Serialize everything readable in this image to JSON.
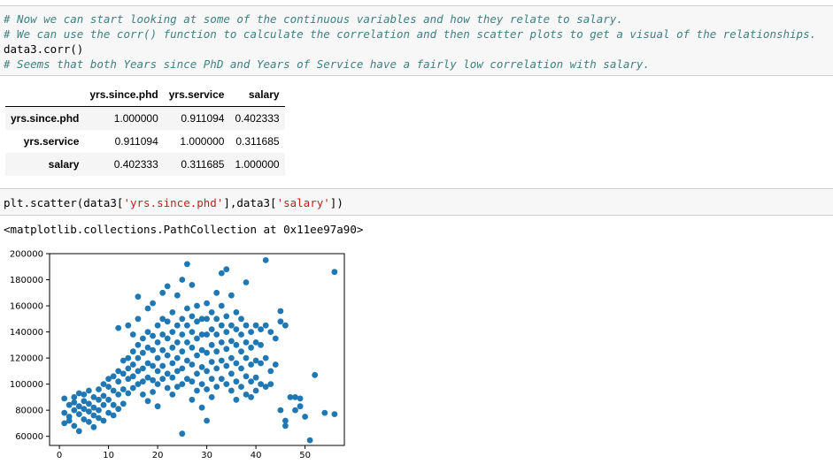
{
  "cell1": {
    "lines": [
      {
        "kind": "comment",
        "text": "# Now we can start looking at some of the continuous variables and how they relate to salary."
      },
      {
        "kind": "comment",
        "text": "# We can use the corr() function to calculate the correlation and then scatter plots to get a visual of the relationships."
      },
      {
        "kind": "plain",
        "text": "data3.corr()"
      },
      {
        "kind": "comment",
        "text": "# Seems that both Years since PhD and Years of Service have a fairly low correlation with salary."
      }
    ]
  },
  "corr_table": {
    "columns": [
      "yrs.since.phd",
      "yrs.service",
      "salary"
    ],
    "rows": [
      {
        "label": "yrs.since.phd",
        "values": [
          "1.000000",
          "0.911094",
          "0.402333"
        ]
      },
      {
        "label": "yrs.service",
        "values": [
          "0.911094",
          "1.000000",
          "0.311685"
        ]
      },
      {
        "label": "salary",
        "values": [
          "0.402333",
          "0.311685",
          "1.000000"
        ]
      }
    ]
  },
  "cell2": {
    "prefix": "plt.scatter(data3[",
    "str1": "'yrs.since.phd'",
    "mid": "],data3[",
    "str2": "'salary'",
    "suffix": "])"
  },
  "output_text": "<matplotlib.collections.PathCollection at 0x11ee97a90>",
  "chart_data": {
    "type": "scatter",
    "xlim": [
      -2,
      58
    ],
    "ylim": [
      53000,
      200000
    ],
    "x_ticks": [
      0,
      10,
      20,
      30,
      40,
      50
    ],
    "y_ticks": [
      60000,
      80000,
      100000,
      120000,
      140000,
      160000,
      180000,
      200000
    ],
    "point_color": "#1f77b4",
    "points": [
      [
        1,
        89000
      ],
      [
        1,
        78000
      ],
      [
        1,
        70000
      ],
      [
        2,
        84000
      ],
      [
        2,
        75000
      ],
      [
        2,
        72000
      ],
      [
        3,
        90000
      ],
      [
        3,
        80000
      ],
      [
        3,
        68000
      ],
      [
        3,
        86000
      ],
      [
        4,
        93000
      ],
      [
        4,
        83000
      ],
      [
        4,
        64000
      ],
      [
        4,
        77000
      ],
      [
        5,
        92000
      ],
      [
        5,
        81000
      ],
      [
        5,
        73000
      ],
      [
        5,
        87000
      ],
      [
        6,
        95000
      ],
      [
        6,
        85000
      ],
      [
        6,
        71000
      ],
      [
        6,
        79000
      ],
      [
        7,
        90000
      ],
      [
        7,
        82000
      ],
      [
        7,
        76000
      ],
      [
        7,
        67000
      ],
      [
        8,
        96000
      ],
      [
        8,
        88000
      ],
      [
        8,
        80000
      ],
      [
        8,
        74000
      ],
      [
        9,
        100000
      ],
      [
        9,
        91000
      ],
      [
        9,
        84000
      ],
      [
        9,
        72000
      ],
      [
        10,
        104000
      ],
      [
        10,
        98000
      ],
      [
        10,
        88000
      ],
      [
        10,
        78000
      ],
      [
        11,
        106000
      ],
      [
        11,
        95000
      ],
      [
        11,
        84000
      ],
      [
        11,
        76000
      ],
      [
        12,
        110000
      ],
      [
        12,
        102000
      ],
      [
        12,
        92000
      ],
      [
        12,
        81000
      ],
      [
        12,
        143000
      ],
      [
        13,
        118000
      ],
      [
        13,
        108000
      ],
      [
        13,
        96000
      ],
      [
        13,
        85000
      ],
      [
        14,
        120000
      ],
      [
        14,
        112000
      ],
      [
        14,
        104000
      ],
      [
        14,
        93000
      ],
      [
        14,
        145000
      ],
      [
        15,
        125000
      ],
      [
        15,
        115000
      ],
      [
        15,
        106000
      ],
      [
        15,
        97000
      ],
      [
        15,
        138000
      ],
      [
        16,
        130000
      ],
      [
        16,
        120000
      ],
      [
        16,
        110000
      ],
      [
        16,
        100000
      ],
      [
        16,
        150000
      ],
      [
        16,
        167000
      ],
      [
        17,
        135000
      ],
      [
        17,
        124000
      ],
      [
        17,
        112000
      ],
      [
        17,
        102000
      ],
      [
        17,
        92000
      ],
      [
        18,
        140000
      ],
      [
        18,
        128000
      ],
      [
        18,
        116000
      ],
      [
        18,
        105000
      ],
      [
        18,
        87000
      ],
      [
        18,
        158000
      ],
      [
        19,
        137000
      ],
      [
        19,
        126000
      ],
      [
        19,
        114000
      ],
      [
        19,
        103000
      ],
      [
        19,
        94000
      ],
      [
        19,
        162000
      ],
      [
        20,
        145000
      ],
      [
        20,
        132000
      ],
      [
        20,
        120000
      ],
      [
        20,
        110000
      ],
      [
        20,
        100000
      ],
      [
        20,
        83000
      ],
      [
        21,
        150000
      ],
      [
        21,
        138000
      ],
      [
        21,
        126000
      ],
      [
        21,
        114000
      ],
      [
        21,
        104000
      ],
      [
        21,
        170000
      ],
      [
        22,
        148000
      ],
      [
        22,
        135000
      ],
      [
        22,
        122000
      ],
      [
        22,
        108000
      ],
      [
        22,
        97000
      ],
      [
        22,
        175000
      ],
      [
        23,
        155000
      ],
      [
        23,
        140000
      ],
      [
        23,
        128000
      ],
      [
        23,
        116000
      ],
      [
        23,
        105000
      ],
      [
        23,
        92000
      ],
      [
        24,
        145000
      ],
      [
        24,
        132000
      ],
      [
        24,
        120000
      ],
      [
        24,
        110000
      ],
      [
        24,
        98000
      ],
      [
        24,
        168000
      ],
      [
        25,
        150000
      ],
      [
        25,
        138000
      ],
      [
        25,
        125000
      ],
      [
        25,
        112000
      ],
      [
        25,
        100000
      ],
      [
        25,
        62000
      ],
      [
        25,
        180000
      ],
      [
        26,
        158000
      ],
      [
        26,
        145000
      ],
      [
        26,
        132000
      ],
      [
        26,
        118000
      ],
      [
        26,
        104000
      ],
      [
        26,
        192000
      ],
      [
        27,
        152000
      ],
      [
        27,
        140000
      ],
      [
        27,
        128000
      ],
      [
        27,
        115000
      ],
      [
        27,
        102000
      ],
      [
        27,
        88000
      ],
      [
        27,
        176000
      ],
      [
        28,
        160000
      ],
      [
        28,
        148000
      ],
      [
        28,
        135000
      ],
      [
        28,
        122000
      ],
      [
        28,
        108000
      ],
      [
        28,
        95000
      ],
      [
        29,
        150000
      ],
      [
        29,
        138000
      ],
      [
        29,
        126000
      ],
      [
        29,
        113000
      ],
      [
        29,
        100000
      ],
      [
        29,
        82000
      ],
      [
        30,
        162000
      ],
      [
        30,
        150000
      ],
      [
        30,
        138000
      ],
      [
        30,
        124000
      ],
      [
        30,
        110000
      ],
      [
        30,
        96000
      ],
      [
        30,
        72000
      ],
      [
        31,
        155000
      ],
      [
        31,
        142000
      ],
      [
        31,
        130000
      ],
      [
        31,
        117000
      ],
      [
        31,
        104000
      ],
      [
        31,
        90000
      ],
      [
        32,
        150000
      ],
      [
        32,
        138000
      ],
      [
        32,
        125000
      ],
      [
        32,
        112000
      ],
      [
        32,
        98000
      ],
      [
        32,
        170000
      ],
      [
        33,
        160000
      ],
      [
        33,
        145000
      ],
      [
        33,
        132000
      ],
      [
        33,
        118000
      ],
      [
        33,
        104000
      ],
      [
        33,
        185000
      ],
      [
        34,
        152000
      ],
      [
        34,
        140000
      ],
      [
        34,
        127000
      ],
      [
        34,
        114000
      ],
      [
        34,
        100000
      ],
      [
        34,
        188000
      ],
      [
        35,
        145000
      ],
      [
        35,
        133000
      ],
      [
        35,
        120000
      ],
      [
        35,
        108000
      ],
      [
        35,
        95000
      ],
      [
        35,
        168000
      ],
      [
        36,
        155000
      ],
      [
        36,
        142000
      ],
      [
        36,
        130000
      ],
      [
        36,
        116000
      ],
      [
        36,
        102000
      ],
      [
        36,
        88000
      ],
      [
        37,
        150000
      ],
      [
        37,
        138000
      ],
      [
        37,
        125000
      ],
      [
        37,
        112000
      ],
      [
        37,
        98000
      ],
      [
        38,
        145000
      ],
      [
        38,
        132000
      ],
      [
        38,
        120000
      ],
      [
        38,
        106000
      ],
      [
        38,
        92000
      ],
      [
        38,
        178000
      ],
      [
        39,
        140000
      ],
      [
        39,
        128000
      ],
      [
        39,
        115000
      ],
      [
        39,
        102000
      ],
      [
        39,
        90000
      ],
      [
        40,
        145000
      ],
      [
        40,
        132000
      ],
      [
        40,
        118000
      ],
      [
        40,
        105000
      ],
      [
        40,
        95000
      ],
      [
        41,
        142000
      ],
      [
        41,
        130000
      ],
      [
        41,
        116000
      ],
      [
        41,
        100000
      ],
      [
        42,
        195000
      ],
      [
        42,
        145000
      ],
      [
        42,
        120000
      ],
      [
        42,
        98000
      ],
      [
        43,
        140000
      ],
      [
        43,
        110000
      ],
      [
        43,
        100000
      ],
      [
        44,
        135000
      ],
      [
        44,
        115000
      ],
      [
        45,
        156000
      ],
      [
        45,
        148000
      ],
      [
        45,
        80000
      ],
      [
        46,
        145000
      ],
      [
        46,
        72000
      ],
      [
        46,
        68000
      ],
      [
        47,
        90000
      ],
      [
        48,
        90000
      ],
      [
        48,
        80000
      ],
      [
        49,
        89000
      ],
      [
        49,
        83000
      ],
      [
        50,
        75000
      ],
      [
        51,
        57000
      ],
      [
        52,
        107000
      ],
      [
        54,
        78000
      ],
      [
        56,
        186000
      ],
      [
        56,
        77000
      ]
    ]
  }
}
